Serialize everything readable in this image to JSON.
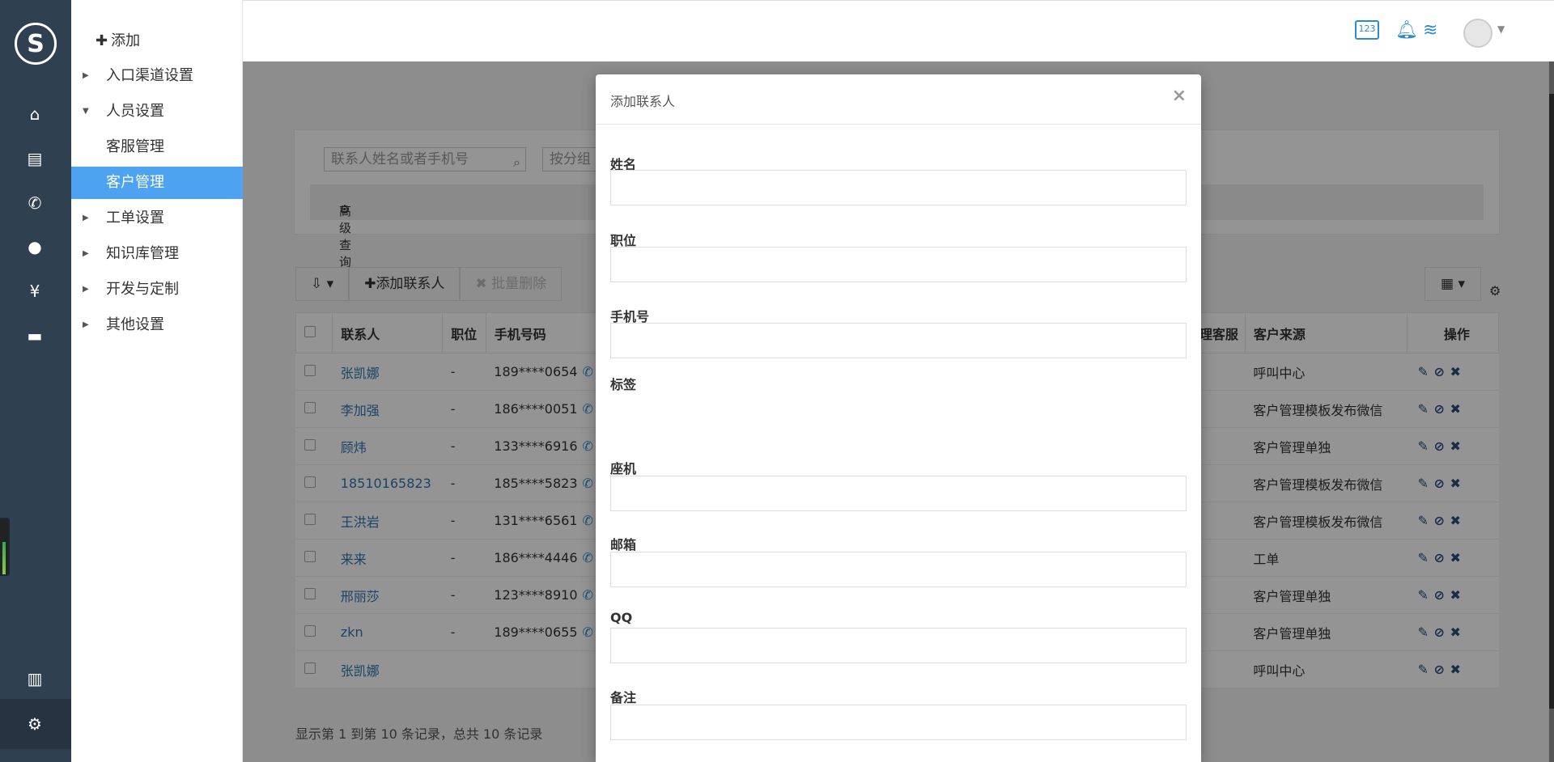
{
  "rail": {
    "icons": [
      "home-icon",
      "clipboard-icon",
      "phone-icon",
      "chat-icon",
      "money-bag-icon",
      "folder-icon",
      "bar-chart-icon",
      "gear-icon"
    ]
  },
  "sidebar": {
    "add_label": "添加",
    "items": [
      {
        "label": "入口渠道设置",
        "caret": "▶"
      },
      {
        "label": "人员设置",
        "caret": "▼"
      },
      {
        "label": "客服管理",
        "caret": ""
      },
      {
        "label": "客户管理",
        "caret": ""
      },
      {
        "label": "工单设置",
        "caret": "▶"
      },
      {
        "label": "知识库管理",
        "caret": "▶"
      },
      {
        "label": "开发与定制",
        "caret": "▶"
      },
      {
        "label": "其他设置",
        "caret": "▶"
      }
    ]
  },
  "topbar": {
    "badge_text": "123"
  },
  "search": {
    "placeholder": "联系人姓名或者手机号",
    "group_placeholder": "按分组"
  },
  "advanced": {
    "label": "高级查询器"
  },
  "toolbar": {
    "add_contact": "添加联系人",
    "batch_delete": "批量删除"
  },
  "table": {
    "headers": [
      "联系人",
      "职位",
      "手机号码",
      "经理客服",
      "客户来源",
      "操作"
    ],
    "rows": [
      {
        "name": "张凯娜",
        "title": "-",
        "phone": "189****0654",
        "source": "呼叫中心"
      },
      {
        "name": "李加强",
        "title": "-",
        "phone": "186****0051",
        "source": "客户管理模板发布微信"
      },
      {
        "name": "顾炜",
        "title": "-",
        "phone": "133****6916",
        "source": "客户管理单独"
      },
      {
        "name": "18510165823",
        "title": "-",
        "phone": "185****5823",
        "source": "客户管理模板发布微信"
      },
      {
        "name": "王洪岩",
        "title": "-",
        "phone": "131****6561",
        "source": "客户管理模板发布微信"
      },
      {
        "name": "来来",
        "title": "-",
        "phone": "186****4446",
        "source": "工单"
      },
      {
        "name": "邢丽莎",
        "title": "-",
        "phone": "123****8910",
        "source": "客户管理单独"
      },
      {
        "name": "zkn",
        "title": "-",
        "phone": "189****0655",
        "source": "客户管理单独"
      },
      {
        "name": "张凯娜",
        "title": "",
        "phone": "",
        "source": "呼叫中心"
      }
    ]
  },
  "footer": {
    "info": "显示第 1 到第 10 条记录，总共 10 条记录"
  },
  "modal": {
    "title": "添加联系人",
    "close": "×",
    "fields": {
      "name": "姓名",
      "position": "职位",
      "mobile": "手机号",
      "tags": "标签",
      "landline": "座机",
      "email": "邮箱",
      "qq": "QQ",
      "note": "备注"
    }
  }
}
